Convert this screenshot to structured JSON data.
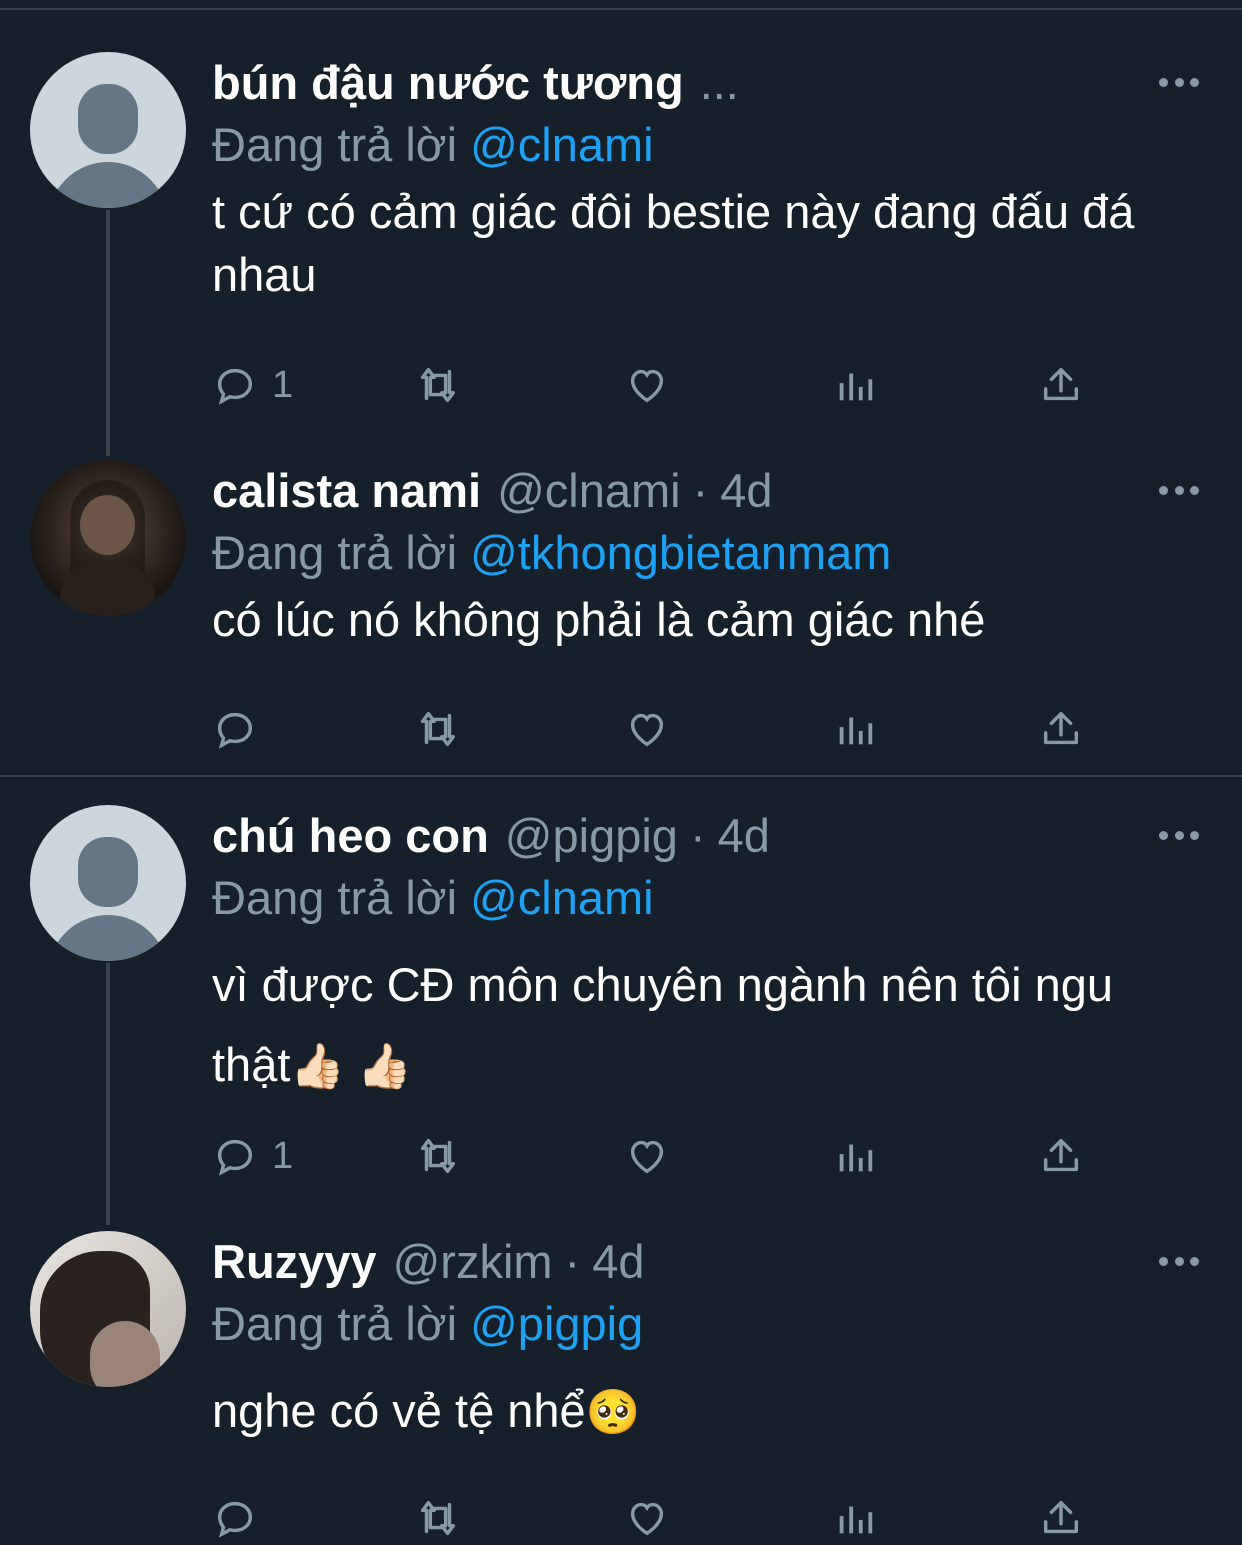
{
  "colors": {
    "background": "#15202b",
    "text_primary": "#ffffff",
    "text_secondary": "#8899a6",
    "mention": "#1da1f2",
    "divider": "#38444d"
  },
  "reply_prefix": "Đang trả lời",
  "tweets": [
    {
      "name": "bún đậu nước tương",
      "handle": "",
      "sep": "",
      "time": "",
      "ellipsis": "...",
      "reply_to": "@clnami",
      "text": "t cứ có cảm giác đôi bestie này đang đấu đá nhau",
      "emoji": "",
      "reply_count": "1"
    },
    {
      "name": "calista nami",
      "handle": "@clnami",
      "sep": "·",
      "time": "4d",
      "ellipsis": "",
      "reply_to": "@tkhongbietanmam",
      "text": "có lúc nó không phải là cảm giác nhé",
      "emoji": "",
      "reply_count": ""
    },
    {
      "name": "chú heo con",
      "handle": "@pigpig",
      "sep": "·",
      "time": "4d",
      "ellipsis": "",
      "reply_to": "@clnami",
      "text": "vì được CĐ môn chuyên ngành nên tôi ngu thật",
      "emoji": "👍🏻 👍🏻",
      "reply_count": "1"
    },
    {
      "name": "Ruzyyy",
      "handle": "@rzkim",
      "sep": "·",
      "time": "4d",
      "ellipsis": "",
      "reply_to": "@pigpig",
      "text": "nghe có vẻ tệ nhể",
      "emoji": "🥺",
      "reply_count": ""
    }
  ],
  "icons": [
    "reply-icon",
    "retweet-icon",
    "like-icon",
    "analytics-icon",
    "share-icon",
    "more-icon",
    "default-avatar-icon"
  ]
}
